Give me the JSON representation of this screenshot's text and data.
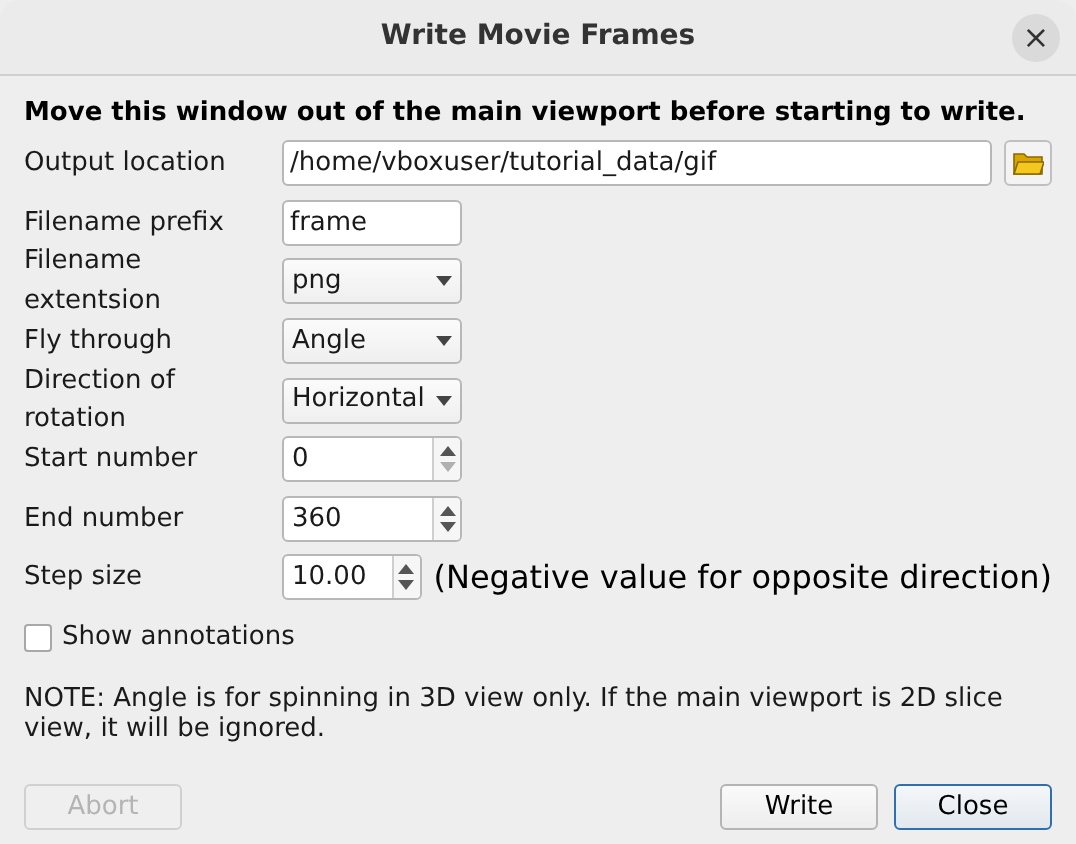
{
  "window": {
    "title": "Write Movie Frames",
    "close": "×"
  },
  "heading": "Move this window out of the main viewport before starting to write.",
  "fields": [
    {
      "kind": "path",
      "label": "Output location",
      "value": "/home/vboxuser/tutorial_data/gif"
    },
    {
      "kind": "text",
      "label": "Filename prefix",
      "value": "frame"
    },
    {
      "kind": "combo",
      "label": "Filename extentsion",
      "value": "png"
    },
    {
      "kind": "combo",
      "label": "Fly through",
      "value": "Angle"
    },
    {
      "kind": "combo",
      "label": "Direction of rotation",
      "value": "Horizontal"
    },
    {
      "kind": "spin",
      "label": "Start number",
      "value": "0",
      "down_disabled": true
    },
    {
      "kind": "spin",
      "label": "End number",
      "value": "360",
      "down_disabled": false
    },
    {
      "kind": "spin",
      "label": "Step size",
      "value": "10.00",
      "down_disabled": false,
      "hint": "(Negative value for opposite direction)"
    }
  ],
  "show_annotations": {
    "label": "Show annotations",
    "checked": false
  },
  "note": "NOTE: Angle is for spinning in 3D view only. If the main viewport is 2D slice view, it will be ignored.",
  "buttons": [
    {
      "label": "Abort",
      "disabled": true,
      "default": false
    },
    {
      "label": "Write",
      "disabled": false,
      "default": false
    },
    {
      "label": "Close",
      "disabled": false,
      "default": true
    }
  ]
}
